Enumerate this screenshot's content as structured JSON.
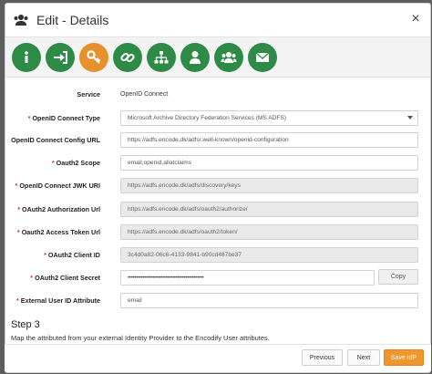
{
  "dialog": {
    "title": "Edit - Details",
    "close_glyph": "×"
  },
  "tabs": [
    {
      "icon": "info-icon",
      "color": "#2e8b47"
    },
    {
      "icon": "sign-in-icon",
      "color": "#2e8b47"
    },
    {
      "icon": "key-icon",
      "color": "#e8902e",
      "active": true
    },
    {
      "icon": "link-icon",
      "color": "#2e8b47"
    },
    {
      "icon": "sitemap-icon",
      "color": "#2e8b47"
    },
    {
      "icon": "user-icon",
      "color": "#2e8b47"
    },
    {
      "icon": "users-icon",
      "color": "#2e8b47"
    },
    {
      "icon": "envelope-icon",
      "color": "#2e8b47"
    }
  ],
  "form": {
    "service": {
      "label": "Service",
      "value": "OpenID Connect"
    },
    "connect_type": {
      "label": "OpenID Connect Type",
      "required": "*",
      "value": "Microsoft Archive Directory Federation Services (MS ADFS)"
    },
    "config_url": {
      "label": "OpenID Connect Config URL",
      "value": "https://adfs.encode.dk/adfs/.well-known/openid-configuration"
    },
    "scope": {
      "label": "Oauth2 Scope",
      "required": "*",
      "value": "email,openid,allatclaims"
    },
    "jwk_uri": {
      "label": "OpenID Connect JWK URI",
      "required": "*",
      "value": "https://adfs.encode.dk/adfs/discovery/keys"
    },
    "auth_url": {
      "label": "OAuth2 Authorization Url",
      "required": "*",
      "value": "https://adfs.encode.dk/adfs/oauth2/authorize/"
    },
    "token_url": {
      "label": "Oauth2 Access Token Url",
      "required": "*",
      "value": "https://adfs.encode.dk/adfs/oauth2/token/"
    },
    "client_id": {
      "label": "OAuth2 Client ID",
      "required": "*",
      "value": "3c4d0a82-06c6-4133-9841-b90cd487be37"
    },
    "client_secret": {
      "label": "OAuth2 Client Secret",
      "required": "*",
      "value": "••••••••••••••••••••••••••••••••••••••••••••••",
      "copy_label": "Copy"
    },
    "external_user": {
      "label": "External User ID Attribute",
      "required": "*",
      "value": "email"
    }
  },
  "step": {
    "title": "Step 3",
    "description": "Map the attributed from your external Identity Provider to the Encodify User attributes."
  },
  "footer": {
    "previous": "Previous",
    "next": "Next",
    "save": "Save IdP"
  },
  "colors": {
    "accent_green": "#2e8b47",
    "accent_orange": "#e8902e",
    "required_red": "#d9342b"
  }
}
